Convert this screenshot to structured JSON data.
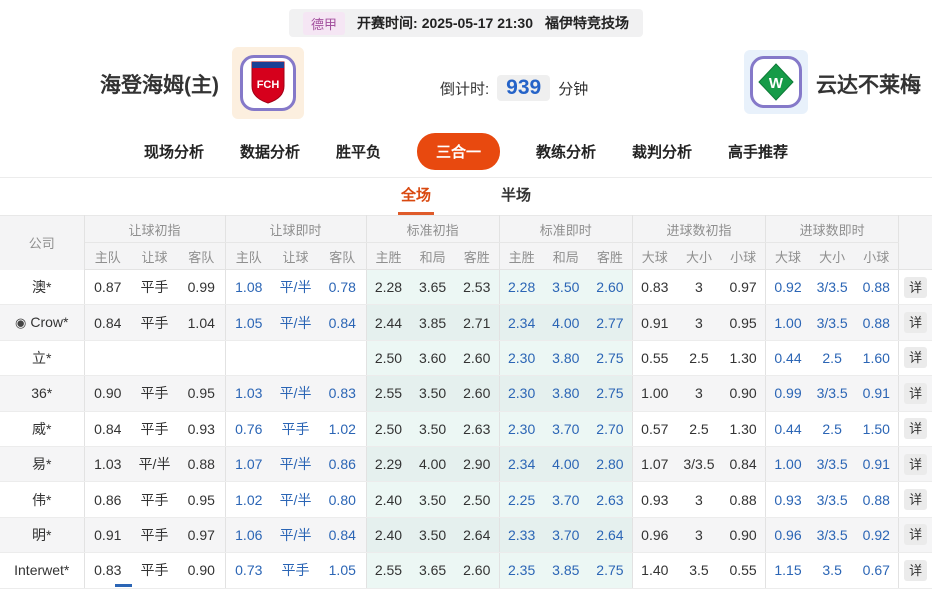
{
  "colors": {
    "accent_orange": "#E8490F",
    "subtab_active_orange": "#D9480F",
    "live_odds_blue": "#2B65B5",
    "countdown_blue": "#2563C8",
    "league_badge_purple": "#A3509E",
    "logo_border_purple": "#8579C9",
    "home_logo_red": "#D6001C",
    "away_logo_green": "#169B48",
    "standard_cols_tint": "#EAF6F2",
    "zebra_row_gray": "#F5F5F6"
  },
  "match_bar": {
    "league": "德甲",
    "kickoff_label": "开赛时间:",
    "kickoff_time": "2025-05-17 21:30",
    "venue": "福伊特竞技场"
  },
  "teams": {
    "home": {
      "name": "海登海姆(主)",
      "logo_text": "FCH"
    },
    "away": {
      "name": "云达不莱梅",
      "logo_text": "W"
    }
  },
  "countdown": {
    "label": "倒计时:",
    "value": "939",
    "unit": "分钟"
  },
  "nav_tabs": [
    {
      "key": "live-analysis",
      "label": "现场分析",
      "active": false
    },
    {
      "key": "data-analysis",
      "label": "数据分析",
      "active": false
    },
    {
      "key": "win-draw-lose",
      "label": "胜平负",
      "active": false
    },
    {
      "key": "three-in-one",
      "label": "三合一",
      "active": true
    },
    {
      "key": "coach-analysis",
      "label": "教练分析",
      "active": false
    },
    {
      "key": "referee-analysis",
      "label": "裁判分析",
      "active": false
    },
    {
      "key": "expert-picks",
      "label": "高手推荐",
      "active": false
    }
  ],
  "sub_tabs": [
    {
      "key": "full-match",
      "label": "全场",
      "active": true
    },
    {
      "key": "half-match",
      "label": "半场",
      "active": false
    }
  ],
  "table": {
    "company_header": "公司",
    "detail_label": "详",
    "groups": [
      {
        "label": "让球初指",
        "cols": [
          "主队",
          "让球",
          "客队"
        ]
      },
      {
        "label": "让球即时",
        "cols": [
          "主队",
          "让球",
          "客队"
        ]
      },
      {
        "label": "标准初指",
        "cols": [
          "主胜",
          "和局",
          "客胜"
        ]
      },
      {
        "label": "标准即时",
        "cols": [
          "主胜",
          "和局",
          "客胜"
        ]
      },
      {
        "label": "进球数初指",
        "cols": [
          "大球",
          "大小",
          "小球"
        ]
      },
      {
        "label": "进球数即时",
        "cols": [
          "大球",
          "大小",
          "小球"
        ]
      }
    ],
    "rows": [
      {
        "company": "澳*",
        "icon": false,
        "odds": [
          [
            "0.87",
            "平手",
            "0.99"
          ],
          [
            "1.08",
            "平/半",
            "0.78"
          ],
          [
            "2.28",
            "3.65",
            "2.53"
          ],
          [
            "2.28",
            "3.50",
            "2.60"
          ],
          [
            "0.83",
            "3",
            "0.97"
          ],
          [
            "0.92",
            "3/3.5",
            "0.88"
          ]
        ]
      },
      {
        "company": "Crow*",
        "icon": true,
        "odds": [
          [
            "0.84",
            "平手",
            "1.04"
          ],
          [
            "1.05",
            "平/半",
            "0.84"
          ],
          [
            "2.44",
            "3.85",
            "2.71"
          ],
          [
            "2.34",
            "4.00",
            "2.77"
          ],
          [
            "0.91",
            "3",
            "0.95"
          ],
          [
            "1.00",
            "3/3.5",
            "0.88"
          ]
        ]
      },
      {
        "company": "立*",
        "icon": false,
        "odds": [
          [
            "",
            "",
            ""
          ],
          [
            "",
            "",
            ""
          ],
          [
            "2.50",
            "3.60",
            "2.60"
          ],
          [
            "2.30",
            "3.80",
            "2.75"
          ],
          [
            "0.55",
            "2.5",
            "1.30"
          ],
          [
            "0.44",
            "2.5",
            "1.60"
          ]
        ]
      },
      {
        "company": "36*",
        "icon": false,
        "odds": [
          [
            "0.90",
            "平手",
            "0.95"
          ],
          [
            "1.03",
            "平/半",
            "0.83"
          ],
          [
            "2.55",
            "3.50",
            "2.60"
          ],
          [
            "2.30",
            "3.80",
            "2.75"
          ],
          [
            "1.00",
            "3",
            "0.90"
          ],
          [
            "0.99",
            "3/3.5",
            "0.91"
          ]
        ]
      },
      {
        "company": "威*",
        "icon": false,
        "odds": [
          [
            "0.84",
            "平手",
            "0.93"
          ],
          [
            "0.76",
            "平手",
            "1.02"
          ],
          [
            "2.50",
            "3.50",
            "2.63"
          ],
          [
            "2.30",
            "3.70",
            "2.70"
          ],
          [
            "0.57",
            "2.5",
            "1.30"
          ],
          [
            "0.44",
            "2.5",
            "1.50"
          ]
        ]
      },
      {
        "company": "易*",
        "icon": false,
        "odds": [
          [
            "1.03",
            "平/半",
            "0.88"
          ],
          [
            "1.07",
            "平/半",
            "0.86"
          ],
          [
            "2.29",
            "4.00",
            "2.90"
          ],
          [
            "2.34",
            "4.00",
            "2.80"
          ],
          [
            "1.07",
            "3/3.5",
            "0.84"
          ],
          [
            "1.00",
            "3/3.5",
            "0.91"
          ]
        ]
      },
      {
        "company": "伟*",
        "icon": false,
        "odds": [
          [
            "0.86",
            "平手",
            "0.95"
          ],
          [
            "1.02",
            "平/半",
            "0.80"
          ],
          [
            "2.40",
            "3.50",
            "2.50"
          ],
          [
            "2.25",
            "3.70",
            "2.63"
          ],
          [
            "0.93",
            "3",
            "0.88"
          ],
          [
            "0.93",
            "3/3.5",
            "0.88"
          ]
        ]
      },
      {
        "company": "明*",
        "icon": false,
        "odds": [
          [
            "0.91",
            "平手",
            "0.97"
          ],
          [
            "1.06",
            "平/半",
            "0.84"
          ],
          [
            "2.40",
            "3.50",
            "2.64"
          ],
          [
            "2.33",
            "3.70",
            "2.64"
          ],
          [
            "0.96",
            "3",
            "0.90"
          ],
          [
            "0.96",
            "3/3.5",
            "0.92"
          ]
        ]
      },
      {
        "company": "Interwet*",
        "icon": false,
        "odds": [
          [
            "0.83",
            "平手",
            "0.90"
          ],
          [
            "0.73",
            "平手",
            "1.05"
          ],
          [
            "2.55",
            "3.65",
            "2.60"
          ],
          [
            "2.35",
            "3.85",
            "2.75"
          ],
          [
            "1.40",
            "3.5",
            "0.55"
          ],
          [
            "1.15",
            "3.5",
            "0.67"
          ]
        ]
      }
    ]
  }
}
